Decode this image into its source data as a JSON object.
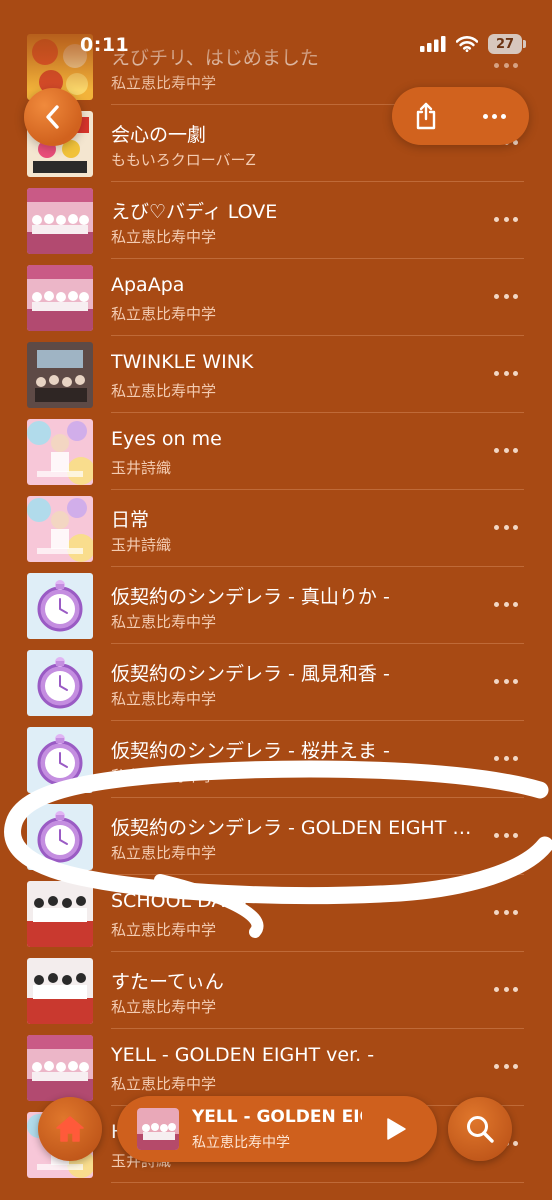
{
  "status_bar": {
    "time": "0:11",
    "battery": "27"
  },
  "theme": {
    "background": "#A84A14",
    "accent": "#D1621E",
    "annotation": "#FFFFFF"
  },
  "top_bar": {
    "back_icon": "chevron-left-icon",
    "share_icon": "share-icon",
    "more_icon": "ellipsis-icon"
  },
  "songs": [
    {
      "title": "えびチリ、はじめました",
      "artist": "私立恵比寿中学",
      "art": "food-collage"
    },
    {
      "title": "会心の一劇",
      "artist": "ももいろクローバーZ",
      "art": "poster"
    },
    {
      "title": "えび♡バディ LOVE",
      "artist": "私立恵比寿中学",
      "art": "group-pink"
    },
    {
      "title": "ApaApa",
      "artist": "私立恵比寿中学",
      "art": "group-pink"
    },
    {
      "title": "TWINKLE WINK",
      "artist": "私立恵比寿中学",
      "art": "group-dark"
    },
    {
      "title": "Eyes on me",
      "artist": "玉井詩織",
      "art": "colors"
    },
    {
      "title": "日常",
      "artist": "玉井詩織",
      "art": "colors"
    },
    {
      "title": "仮契約のシンデレラ - 真山りか -",
      "artist": "私立恵比寿中学",
      "art": "clock"
    },
    {
      "title": "仮契約のシンデレラ - 風見和香 -",
      "artist": "私立恵比寿中学",
      "art": "clock"
    },
    {
      "title": "仮契約のシンデレラ - 桜井えま -",
      "artist": "私立恵比寿中学",
      "art": "clock"
    },
    {
      "title": "仮契約のシンデレラ - GOLDEN EIGHT ver. -",
      "artist": "私立恵比寿中学",
      "art": "clock"
    },
    {
      "title": "SCHOOL DAYS",
      "artist": "私立恵比寿中学",
      "art": "group-red"
    },
    {
      "title": "すたーてぃん",
      "artist": "私立恵比寿中学",
      "art": "group-red"
    },
    {
      "title": "YELL - GOLDEN EIGHT ver. -",
      "artist": "私立恵比寿中学",
      "art": "group-pink"
    },
    {
      "title": "HARVEST",
      "artist": "玉井詩織",
      "art": "colors"
    }
  ],
  "now_playing": {
    "title": "YELL - GOLDEN EIGHT ver. -",
    "artist": "私立恵比寿中学",
    "play_icon": "play-icon"
  },
  "bottom_bar": {
    "home_icon": "home-icon",
    "search_icon": "search-icon"
  }
}
